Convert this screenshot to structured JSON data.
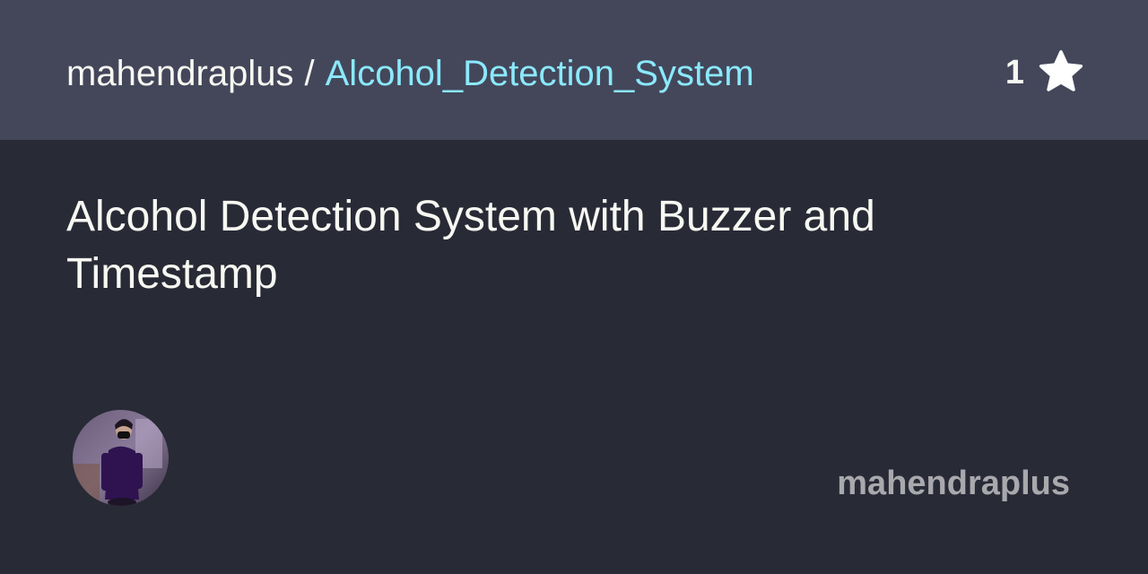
{
  "header": {
    "owner": "mahendraplus",
    "separator": "/",
    "repo_name": "Alcohol_Detection_System",
    "star_count": "1",
    "star_icon": "star-icon"
  },
  "main": {
    "description": "Alcohol Detection System with Buzzer and Timestamp"
  },
  "footer": {
    "avatar_icon": "avatar",
    "username": "mahendraplus"
  },
  "colors": {
    "header_bg": "#44475a",
    "body_bg": "#282a36",
    "repo_link": "#8be9fd",
    "username": "#a8a8ad"
  }
}
